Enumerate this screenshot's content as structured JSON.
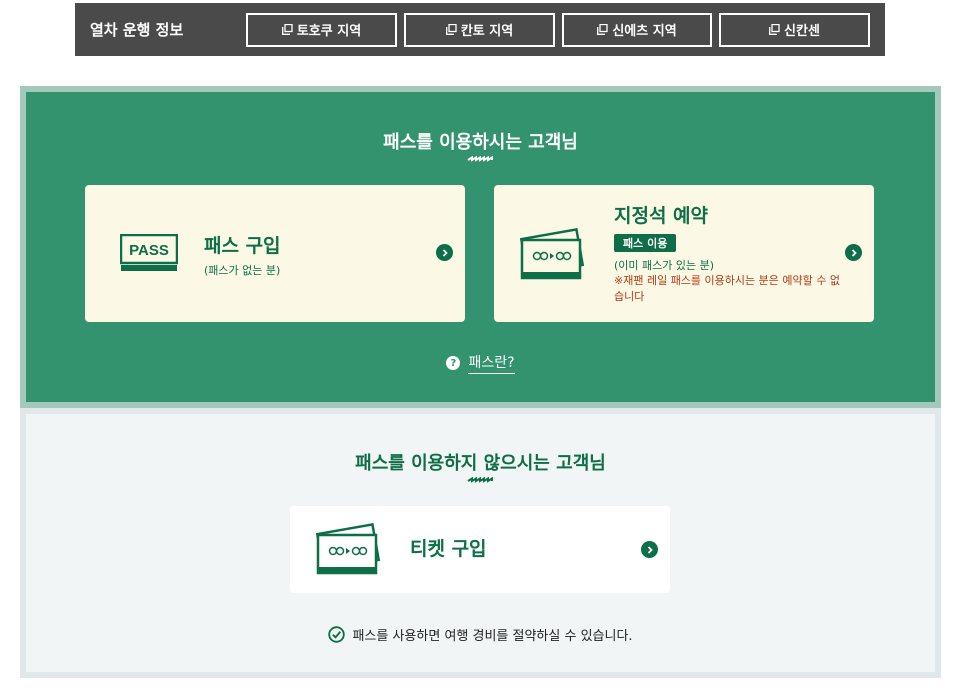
{
  "topbar": {
    "title": "열차 운행 정보",
    "regions": [
      {
        "label": "토호쿠 지역"
      },
      {
        "label": "칸토 지역"
      },
      {
        "label": "신에츠 지역"
      },
      {
        "label": "신칸센"
      }
    ]
  },
  "pass_section": {
    "title": "패스를 이용하시는 고객님",
    "cards": {
      "buy_pass": {
        "icon_text": "PASS",
        "title": "패스 구입",
        "sub": "(패스가 없는 분)"
      },
      "reserve": {
        "title": "지정석 예약",
        "badge": "패스 이용",
        "sub": "(이미 패스가 있는 분)",
        "warning": "※재팬 레일 패스를 이용하시는 분은 예약할 수 없습니다"
      }
    },
    "whatis_link": "패스란?"
  },
  "nopass_section": {
    "title": "패스를 이용하지 않으시는 고객님",
    "ticket_card": {
      "title": "티켓 구입"
    },
    "saving_note": "패스를 사용하면 여행 경비를 절약하실 수 있습니다."
  },
  "colors": {
    "primary_green": "#0d6e47",
    "section_green": "#33936f",
    "card_cream": "#fbf9e6",
    "warning": "#b33a12",
    "topbar": "#4a4a4a"
  }
}
